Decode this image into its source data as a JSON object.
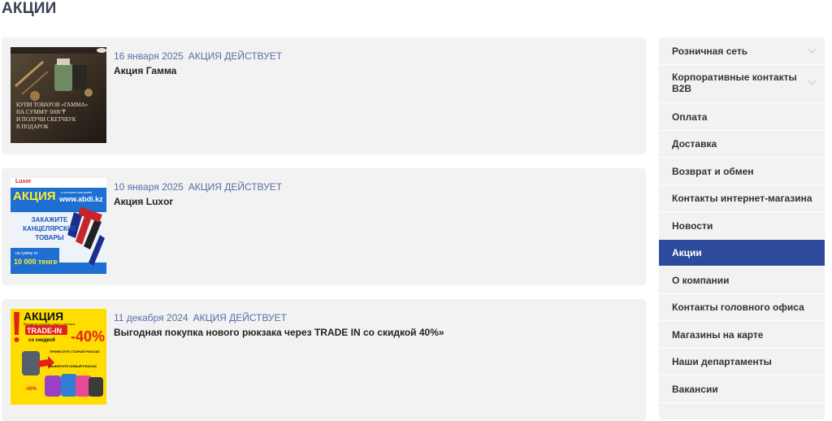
{
  "page": {
    "title": "АКЦИИ"
  },
  "news": [
    {
      "date": "16 января 2025",
      "status": "АКЦИЯ ДЕЙСТВУЕТ",
      "title": "Акция Гамма",
      "image": {
        "lines": [
          "КУПИ ТОВАРОВ «ГАММА»",
          "НА СУММУ 5000 ₸",
          "И ПОЛУЧИ СКЕТЧБУК",
          "В ПОДАРОК"
        ]
      }
    },
    {
      "date": "10 января 2025",
      "status": "АКЦИЯ ДЕЙСТВУЕТ",
      "title": "Акция Luxor",
      "image": {
        "brand": "Luxor",
        "badge": "АКЦИЯ",
        "site_note": "в интернет-магазине",
        "site": "www.abdi.kz",
        "cta": [
          "ЗАКАЖИТЕ",
          "КАНЦЕЛЯРСКИЕ",
          "ТОВАРЫ"
        ],
        "sum_note": "на сумму от",
        "sum": "10 000 тенге"
      }
    },
    {
      "date": "11 декабря 2024",
      "status": "АКЦИЯ ДЕЙСТВУЕТ",
      "title": "Выгодная покупка нового рюкзака через TRADE IN со скидкой 40%»",
      "image": {
        "badge": "АКЦИЯ",
        "subtitle": "Выгодная покупка нового рюкзака",
        "trade": "TRADE-IN",
        "discount": "-40%",
        "with_discount": "со скидкой",
        "step1": "ПРИНЕСИТЕ СТАРЫЙ РЮКЗАК",
        "step2": "ВЫБЕРИТЕ НОВЫЙ РЮКЗАК",
        "small_discount": "-40%"
      }
    }
  ],
  "sidebar": {
    "items": [
      {
        "label": "Розничная сеть",
        "has_children": true,
        "active": false
      },
      {
        "label": "Корпоративные контакты B2B",
        "has_children": true,
        "active": false
      },
      {
        "label": "Оплата",
        "has_children": false,
        "active": false
      },
      {
        "label": "Доставка",
        "has_children": false,
        "active": false
      },
      {
        "label": "Возврат и обмен",
        "has_children": false,
        "active": false
      },
      {
        "label": "Контакты интернет-магазина",
        "has_children": false,
        "active": false
      },
      {
        "label": "Новости",
        "has_children": false,
        "active": false
      },
      {
        "label": "Акции",
        "has_children": false,
        "active": true
      },
      {
        "label": "О компании",
        "has_children": false,
        "active": false
      },
      {
        "label": "Контакты головного офиса",
        "has_children": false,
        "active": false
      },
      {
        "label": "Магазины на карте",
        "has_children": false,
        "active": false
      },
      {
        "label": "Наши департаменты",
        "has_children": false,
        "active": false
      },
      {
        "label": "Вакансии",
        "has_children": false,
        "active": false
      }
    ]
  },
  "colors": {
    "accent": "#2d4a9c",
    "meta": "#5a6ea8",
    "panel": "#f2f2f2",
    "title": "#3a3f52"
  }
}
